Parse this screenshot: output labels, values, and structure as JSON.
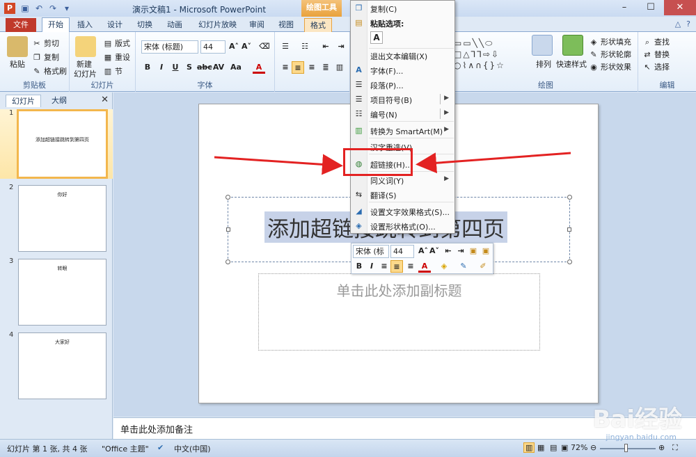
{
  "window": {
    "title": "演示文稿1 - Microsoft PowerPoint",
    "context_tools": "绘图工具",
    "app_letter": "P"
  },
  "tabs": [
    "文件",
    "开始",
    "插入",
    "设计",
    "切换",
    "动画",
    "幻灯片放映",
    "审阅",
    "视图",
    "格式"
  ],
  "ribbon": {
    "clipboard": {
      "paste": "粘贴",
      "cut": "剪切",
      "copy": "复制",
      "format_painter": "格式刷",
      "label": "剪贴板"
    },
    "slides": {
      "new_slide_1": "新建",
      "new_slide_2": "幻灯片",
      "layout": "版式",
      "reset": "重设",
      "section": "节",
      "label": "幻灯片"
    },
    "font": {
      "font_name": "宋体 (标题)",
      "font_size": "44",
      "label": "字体"
    },
    "drawing": {
      "arrange": "排列",
      "quick_styles": "快速样式",
      "shape_fill": "形状填充",
      "shape_outline": "形状轮廓",
      "shape_effects": "形状效果",
      "label": "绘图"
    },
    "editing": {
      "find": "查找",
      "replace": "替换",
      "select": "选择",
      "label": "编辑"
    }
  },
  "left_pane": {
    "tab_slides": "幻灯片",
    "tab_outline": "大纲",
    "slides": [
      {
        "num": "1",
        "text": "添加超链接跳转到第四页"
      },
      {
        "num": "2",
        "text": "你好"
      },
      {
        "num": "3",
        "text": "转眼"
      },
      {
        "num": "4",
        "text": "大家好"
      }
    ]
  },
  "slide": {
    "title": "添加超链接跳转到第四页",
    "subtitle_placeholder": "单击此处添加副标题"
  },
  "mini_toolbar": {
    "font_name": "宋体 (标",
    "font_size": "44"
  },
  "context_menu": {
    "items": [
      {
        "label": "复制(C)"
      },
      {
        "label": "粘贴选项:"
      },
      {
        "label": "退出文本编辑(X)"
      },
      {
        "label": "字体(F)..."
      },
      {
        "label": "段落(P)..."
      },
      {
        "label": "项目符号(B)"
      },
      {
        "label": "编号(N)"
      },
      {
        "label": "转换为 SmartArt(M)"
      },
      {
        "label": "汉字重选(V)"
      },
      {
        "label": "超链接(H)..."
      },
      {
        "label": "同义词(Y)"
      },
      {
        "label": "翻译(S)"
      },
      {
        "label": "设置文字效果格式(S)..."
      },
      {
        "label": "设置形状格式(O)..."
      }
    ],
    "paste_icon": "A"
  },
  "notes": {
    "placeholder": "单击此处添加备注"
  },
  "status_bar": {
    "slide_info": "幻灯片 第 1 张, 共 4 张",
    "theme": "\"Office 主题\"",
    "language": "中文(中国)",
    "zoom": "72%"
  },
  "watermark": {
    "text": "Bai经验",
    "url": "jingyan.baidu.com"
  },
  "colors": {
    "accent": "#c0392b",
    "highlight_box": "#e32222",
    "arrow": "#e32222",
    "context_tab": "#e9a23c"
  }
}
